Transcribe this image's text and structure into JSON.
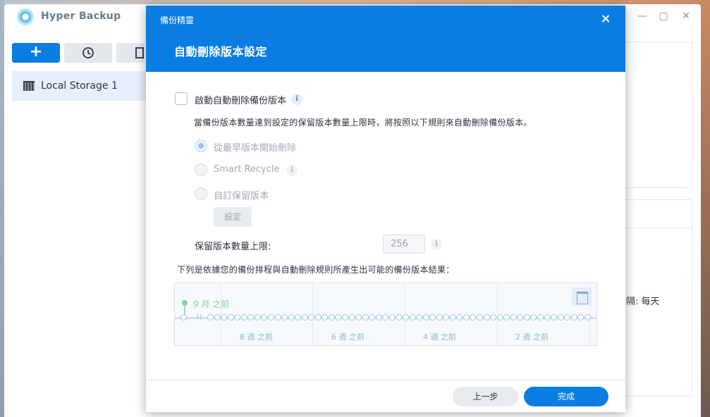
{
  "app": {
    "title": "Hyper Backup",
    "sidebar": {
      "items": [
        {
          "label": "Local Storage 1"
        }
      ]
    },
    "background_fragment": "隔: 每天"
  },
  "modal": {
    "app_name": "備份精靈",
    "title": "自動刪除版本設定",
    "close_icon": "×",
    "enable_checkbox_label": "啟動自動刪除備份版本",
    "enable_checked": false,
    "description": "當備份版本數量達到設定的保留版本數量上限時，將按照以下規則來自動刪除備份版本。",
    "rules": [
      {
        "label": "從最早版本開始刪除",
        "checked": true
      },
      {
        "label": "Smart Recycle",
        "checked": false
      },
      {
        "label": "自訂保留版本",
        "checked": false
      }
    ],
    "settings_button": "設定",
    "limit_label": "保留版本數量上限:",
    "limit_value": "256",
    "result_label": "下列是依據您的備份排程與自動刪除規則所產生出可能的備份版本結果：",
    "timeline": {
      "start_label": "9 月 之前",
      "ticks": [
        "8 週 之前",
        "6 週 之前",
        "4 週 之前",
        "2 週 之前"
      ]
    },
    "buttons": {
      "prev": "上一步",
      "done": "完成"
    }
  }
}
